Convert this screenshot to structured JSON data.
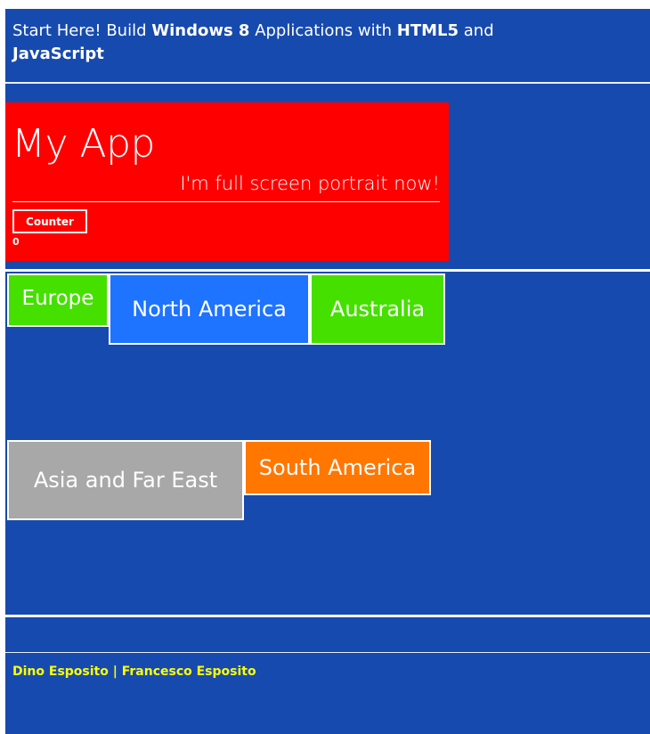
{
  "header": {
    "parts": [
      {
        "text": "Start Here! Build ",
        "bold": false
      },
      {
        "text": "Windows 8",
        "bold": true
      },
      {
        "text": " Applications with ",
        "bold": false
      },
      {
        "text": "HTML5",
        "bold": true
      },
      {
        "text": " and ",
        "bold": false
      },
      {
        "text": "JavaScript",
        "bold": true
      }
    ]
  },
  "app": {
    "title": "My App",
    "subtitle": "I'm full screen portrait now!",
    "counter_label": "Counter",
    "counter_value": "0",
    "color": "#ff0000"
  },
  "tiles": [
    {
      "name": "Europe",
      "color": "#45e000"
    },
    {
      "name": "North America",
      "color": "#1e73ff"
    },
    {
      "name": "Australia",
      "color": "#45e000"
    },
    {
      "name": "Asia and Far East",
      "color": "#a8a8a8"
    },
    {
      "name": "South America",
      "color": "#ff7700"
    }
  ],
  "footer": {
    "credit": "Dino Esposito | Francesco Esposito",
    "credit_color": "#ffff00"
  },
  "colors": {
    "background": "#174aae",
    "divider": "#ffffff"
  }
}
